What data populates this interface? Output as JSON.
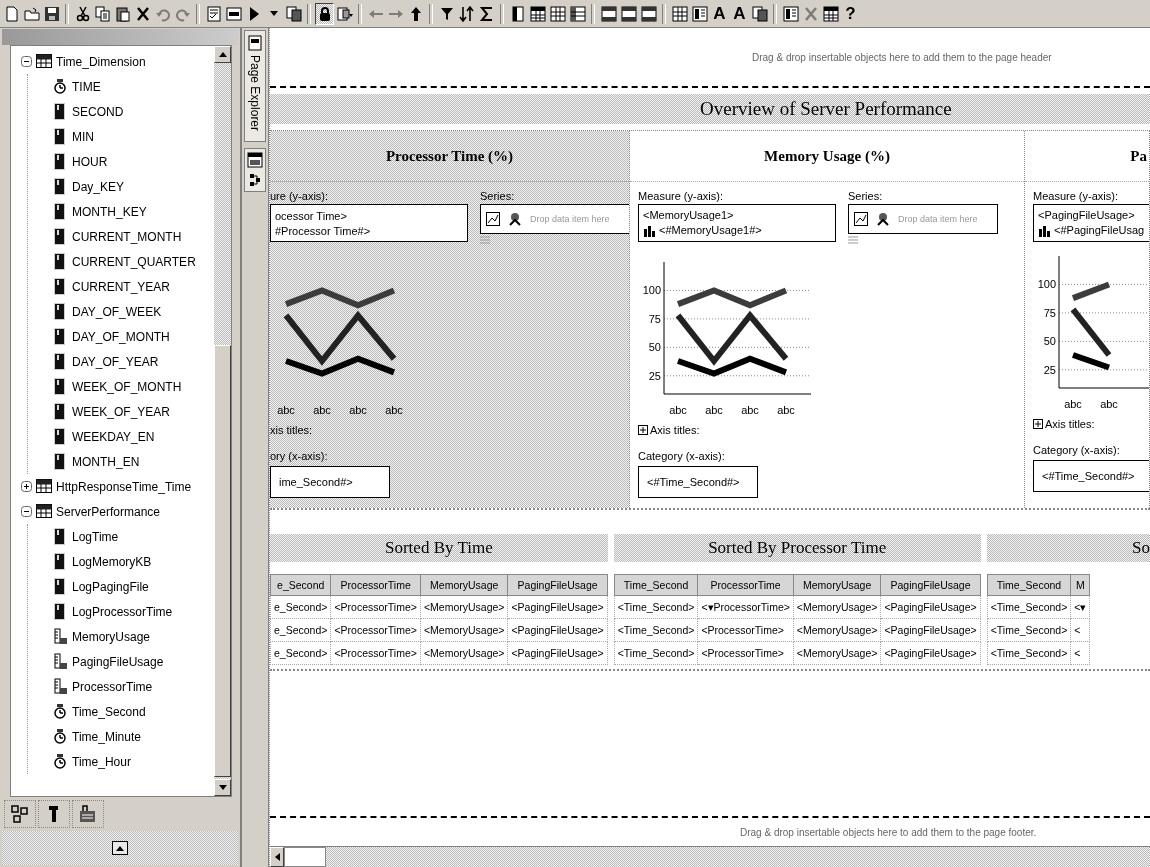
{
  "toolbar": [
    [
      {
        "kind": "new",
        "disabled": false,
        "pressed": false
      },
      {
        "kind": "open",
        "disabled": false,
        "pressed": false
      },
      {
        "kind": "save",
        "disabled": false,
        "pressed": false
      }
    ],
    [
      {
        "kind": "cut",
        "disabled": false,
        "pressed": false
      },
      {
        "kind": "copy",
        "disabled": false,
        "pressed": false
      },
      {
        "kind": "paste",
        "disabled": false,
        "pressed": false
      },
      {
        "kind": "delete",
        "disabled": false,
        "pressed": false
      },
      {
        "kind": "undo",
        "disabled": true,
        "pressed": false
      },
      {
        "kind": "redo",
        "disabled": true,
        "pressed": false
      }
    ],
    [
      {
        "kind": "report",
        "disabled": false,
        "pressed": false
      },
      {
        "kind": "xml",
        "disabled": false,
        "pressed": false
      },
      {
        "kind": "run",
        "disabled": false,
        "pressed": false
      },
      {
        "kind": "caret",
        "disabled": false,
        "pressed": false
      },
      {
        "kind": "pages",
        "disabled": false,
        "pressed": false
      }
    ],
    [
      {
        "kind": "lock",
        "disabled": false,
        "pressed": true
      },
      {
        "kind": "view",
        "disabled": false,
        "pressed": false
      }
    ],
    [
      {
        "kind": "back",
        "disabled": true,
        "pressed": false
      },
      {
        "kind": "forward",
        "disabled": true,
        "pressed": false
      },
      {
        "kind": "up",
        "disabled": false,
        "pressed": false
      }
    ],
    [
      {
        "kind": "filter",
        "disabled": false,
        "pressed": false
      },
      {
        "kind": "sort",
        "disabled": false,
        "pressed": false
      },
      {
        "kind": "sum",
        "disabled": false,
        "pressed": false
      }
    ],
    [
      {
        "kind": "column",
        "disabled": false,
        "pressed": false
      },
      {
        "kind": "table",
        "disabled": false,
        "pressed": false
      },
      {
        "kind": "grid",
        "disabled": false,
        "pressed": false
      },
      {
        "kind": "crosstab",
        "disabled": false,
        "pressed": false
      }
    ],
    [
      {
        "kind": "rows",
        "disabled": false,
        "pressed": false
      },
      {
        "kind": "rows",
        "disabled": false,
        "pressed": false
      },
      {
        "kind": "rows",
        "disabled": false,
        "pressed": false
      }
    ],
    [
      {
        "kind": "grid",
        "disabled": false,
        "pressed": false
      },
      {
        "kind": "layout",
        "disabled": false,
        "pressed": false
      },
      {
        "kind": "letter",
        "label": "A",
        "disabled": false,
        "pressed": false
      },
      {
        "kind": "letter",
        "label": "A",
        "disabled": false,
        "pressed": false
      },
      {
        "kind": "pages",
        "disabled": false,
        "pressed": false
      }
    ],
    [
      {
        "kind": "layout",
        "disabled": false,
        "pressed": false
      },
      {
        "kind": "delete",
        "disabled": true,
        "pressed": false
      },
      {
        "kind": "table",
        "disabled": false,
        "pressed": false
      },
      {
        "kind": "letter",
        "label": "?",
        "disabled": false,
        "pressed": false
      }
    ]
  ],
  "objects_tree": [
    {
      "label": "Time_Dimension",
      "kind": "dimension",
      "expanded": true,
      "children": [
        {
          "label": "TIME",
          "kind": "time"
        },
        {
          "label": "SECOND",
          "kind": "column"
        },
        {
          "label": "MIN",
          "kind": "column"
        },
        {
          "label": "HOUR",
          "kind": "column"
        },
        {
          "label": "Day_KEY",
          "kind": "column"
        },
        {
          "label": "MONTH_KEY",
          "kind": "column"
        },
        {
          "label": "CURRENT_MONTH",
          "kind": "column"
        },
        {
          "label": "CURRENT_QUARTER",
          "kind": "column"
        },
        {
          "label": "CURRENT_YEAR",
          "kind": "column"
        },
        {
          "label": "DAY_OF_WEEK",
          "kind": "column"
        },
        {
          "label": "DAY_OF_MONTH",
          "kind": "column"
        },
        {
          "label": "DAY_OF_YEAR",
          "kind": "column"
        },
        {
          "label": "WEEK_OF_MONTH",
          "kind": "column"
        },
        {
          "label": "WEEK_OF_YEAR",
          "kind": "column"
        },
        {
          "label": "WEEKDAY_EN",
          "kind": "column"
        },
        {
          "label": "MONTH_EN",
          "kind": "column"
        }
      ]
    },
    {
      "label": "HttpResponseTime_Time",
      "kind": "dimension",
      "expanded": false
    },
    {
      "label": "ServerPerformance",
      "kind": "dimension",
      "expanded": true,
      "children": [
        {
          "label": "LogTime",
          "kind": "column"
        },
        {
          "label": "LogMemoryKB",
          "kind": "column"
        },
        {
          "label": "LogPagingFile",
          "kind": "column"
        },
        {
          "label": "LogProcessorTime",
          "kind": "column"
        },
        {
          "label": "MemoryUsage",
          "kind": "measure"
        },
        {
          "label": "PagingFileUsage",
          "kind": "measure"
        },
        {
          "label": "ProcessorTime",
          "kind": "measure"
        },
        {
          "label": "Time_Second",
          "kind": "time"
        },
        {
          "label": "Time_Minute",
          "kind": "time"
        },
        {
          "label": "Time_Hour",
          "kind": "time"
        }
      ]
    }
  ],
  "page_explorer_tab": {
    "label": "Page Explorer"
  },
  "report": {
    "header_hint": "Drag & drop insertable objects here to add them to the page header",
    "title": "Overview of Server Performance",
    "charts": [
      {
        "title": "Processor Time (%)",
        "selected": true,
        "measure_label": "ure (y-axis):",
        "measure_items": [
          {
            "text": "ocessor Time>",
            "kind": "item"
          },
          {
            "text": "#Processor Time#>",
            "kind": "item"
          }
        ],
        "series_label": "Series:",
        "series_hint": "Drop data item here",
        "chart_labels": [
          "abc",
          "abc",
          "abc",
          "abc"
        ],
        "axis_titles_label": "xis titles:",
        "category_label": "ory (x-axis):",
        "category_item": "ime_Second#>"
      },
      {
        "title": "Memory Usage (%)",
        "selected": false,
        "measure_label": "Measure (y-axis):",
        "measure_items": [
          {
            "text": "<MemoryUsage1>",
            "kind": "item"
          },
          {
            "text": "<#MemoryUsage1#>",
            "kind": "label"
          }
        ],
        "series_label": "Series:",
        "series_hint": "Drop data item here",
        "chart_data": {
          "type": "line",
          "categories": [
            "abc",
            "abc",
            "abc",
            "abc"
          ],
          "ylim": [
            9,
            125
          ],
          "yticks": [
            25,
            50,
            75,
            100
          ],
          "grid": true,
          "series": [
            {
              "color": "#3c3c3c",
              "values": [
                88,
                100,
                87,
                100
              ]
            },
            {
              "color": "#222222",
              "values": [
                78,
                38,
                78,
                40
              ]
            },
            {
              "color": "#000000",
              "values": [
                38,
                27,
                40,
                28
              ]
            }
          ]
        },
        "axis_titles_expanded": false,
        "axis_titles_label": "Axis titles:",
        "category_label": "Category (x-axis):",
        "category_item": "<#Time_Second#>"
      },
      {
        "title": "Pa",
        "selected": false,
        "measure_label": "Measure (y-axis):",
        "measure_items": [
          {
            "text": "<PagingFileUsage>",
            "kind": "item"
          },
          {
            "text": "<#PagingFileUsag",
            "kind": "label"
          }
        ],
        "chart_data": {
          "type": "line",
          "categories": [
            "abc",
            "abc"
          ],
          "ylim": [
            9,
            125
          ],
          "yticks": [
            25,
            50,
            75,
            100
          ],
          "grid": true,
          "series": [
            {
              "color": "#3c3c3c",
              "values": [
                88,
                100
              ]
            },
            {
              "color": "#222222",
              "values": [
                78,
                38
              ]
            },
            {
              "color": "#000000",
              "values": [
                38,
                27
              ]
            }
          ]
        },
        "axis_titles_expanded": false,
        "axis_titles_label": "Axis titles:",
        "category_label": "Category (x-axis):",
        "category_item": "<#Time_Second#>"
      }
    ],
    "tables": [
      {
        "title": "Sorted By Time",
        "columns": [
          "e_Second",
          "ProcessorTime",
          "MemoryUsage",
          "PagingFileUsage"
        ],
        "rows": [
          [
            "e_Second>",
            "<ProcessorTime>",
            "<MemoryUsage>",
            "<PagingFileUsage>"
          ],
          [
            "e_Second>",
            "<ProcessorTime>",
            "<MemoryUsage>",
            "<PagingFileUsage>"
          ],
          [
            "e_Second>",
            "<ProcessorTime>",
            "<MemoryUsage>",
            "<PagingFileUsage>"
          ]
        ]
      },
      {
        "title": "Sorted By Processor Time",
        "columns": [
          "Time_Second",
          "ProcessorTime",
          "MemoryUsage",
          "PagingFileUsage"
        ],
        "rows": [
          [
            "<Time_Second>",
            "<▾ProcessorTime>",
            "<MemoryUsage>",
            "<PagingFileUsage>"
          ],
          [
            "<Time_Second>",
            "<ProcessorTime>",
            "<MemoryUsage>",
            "<PagingFileUsage>"
          ],
          [
            "<Time_Second>",
            "<ProcessorTime>",
            "<MemoryUsage>",
            "<PagingFileUsage>"
          ]
        ]
      },
      {
        "title": "So",
        "columns": [
          "Time_Second",
          "M"
        ],
        "rows": [
          [
            "<Time_Second>",
            "<▾"
          ],
          [
            "<Time_Second>",
            "<"
          ],
          [
            "<Time_Second>",
            "<"
          ]
        ]
      }
    ],
    "footer_hint": "Drag & drop insertable objects here to add them to the page footer."
  }
}
